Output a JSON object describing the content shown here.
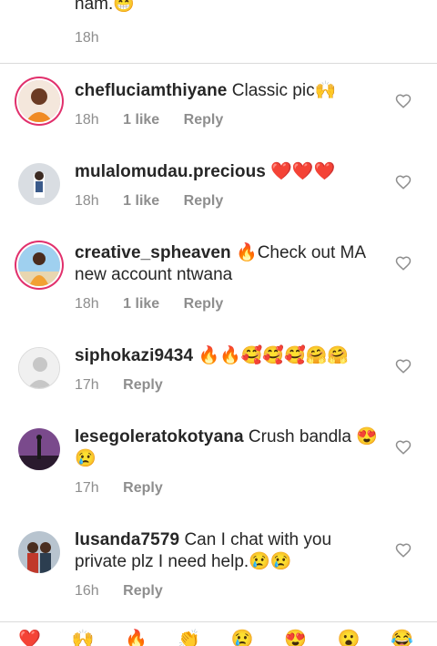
{
  "partial_comment": {
    "text": "nam.😁",
    "time": "18h"
  },
  "comments": [
    {
      "username": "chefluciamthiyane",
      "text": "Classic pic🙌",
      "time": "18h",
      "likes": "1 like",
      "reply": "Reply"
    },
    {
      "username": "mulalomudau.precious",
      "text": "❤️❤️❤️",
      "time": "18h",
      "likes": "1 like",
      "reply": "Reply"
    },
    {
      "username": "creative_spheaven",
      "text": "🔥Check out MA new account ntwana",
      "time": "18h",
      "likes": "1 like",
      "reply": "Reply"
    },
    {
      "username": "siphokazi9434",
      "text": "🔥🔥🥰🥰🥰🤗🤗",
      "time": "17h",
      "likes": "",
      "reply": "Reply"
    },
    {
      "username": "lesegoleratokotyana",
      "text": "Crush bandla 😍😢",
      "time": "17h",
      "likes": "",
      "reply": "Reply"
    },
    {
      "username": "lusanda7579",
      "text": "Can I chat with you private plz I need help.😢😢",
      "time": "16h",
      "likes": "",
      "reply": "Reply"
    }
  ],
  "emoji_bar": [
    "❤️",
    "🙌",
    "🔥",
    "👏",
    "😢",
    "😍",
    "😮",
    "😂"
  ]
}
